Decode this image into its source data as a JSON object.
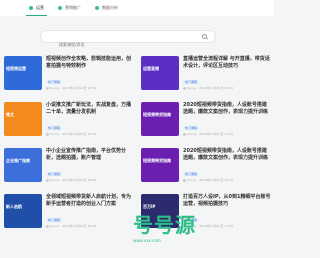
{
  "tabs": [
    {
      "label": "运营"
    },
    {
      "label": "营销推广"
    },
    {
      "label": "数据分析"
    }
  ],
  "search": {
    "placeholder": "搜索课程/资讯"
  },
  "cards": [
    {
      "title": "短视频创作全攻略，剪辑技能运用，创意拍摄与特效制作",
      "tag": "热门课程",
      "meta": "Sunny · 2023年11月21日 10:30",
      "thumb_text": "短视频运营",
      "thumb_bg": "#2e6bd8"
    },
    {
      "title": "直播运营全流程详解 与开直播，带货话术设计，评论区互动技巧",
      "tag": "热门课程",
      "meta": "Sunny · 2023年11月21日 11:00",
      "thumb_text": "运营直播",
      "thumb_bg": "#5b2fc5"
    },
    {
      "title": "小说推文推广新玩法，实战复盘，万播二十单，流量分发机制",
      "tag": "热门课程",
      "meta": "Sunny · 2023年11月21日 12:00",
      "thumb_text": "推文",
      "thumb_bg": "#f28a1d"
    },
    {
      "title": "2020短视频带货指南，人设账号搭建选题，爆款文案创作，表现力提升训练",
      "tag": "热门课程",
      "meta": "Sunny · 2023年11月21日 13:00",
      "thumb_text": "短视频带货指南",
      "thumb_bg": "#6a1fb0"
    },
    {
      "title": "中小企业宣传推广指南，平台优势分析，选题拍摄，账户管理",
      "tag": "热门课程",
      "meta": "Sunny · 2023年11月21日 14:00",
      "thumb_text": "企业推广指南",
      "thumb_bg": "#3c6fd9"
    },
    {
      "title": "2020短视频带货指南，人设账号搭建选题，爆款文案创作，表现力提升训练",
      "tag": "热门课程",
      "meta": "Sunny · 2023年11月21日 15:00",
      "thumb_text": "短视频带货指南",
      "thumb_bg": "#6a1fb0"
    },
    {
      "title": "全领域短视频带货新人启航计划，专为新手运营者打造的创业入门方案",
      "tag": "热门课程",
      "meta": "Sunny · 2023年11月21日 16:00",
      "thumb_text": "新人启航",
      "thumb_bg": "#1f4fa8"
    },
    {
      "title": "打造百万人设IP，从0到1精细平台账号运营，视频拍摄技巧",
      "tag": "热门课程",
      "meta": "Sunny · 2023年11月21日 17:00",
      "thumb_text": "百万IP",
      "thumb_bg": "#2b2b6e"
    }
  ],
  "watermark": {
    "text": "号号源",
    "sub": "www.xxx.com"
  }
}
